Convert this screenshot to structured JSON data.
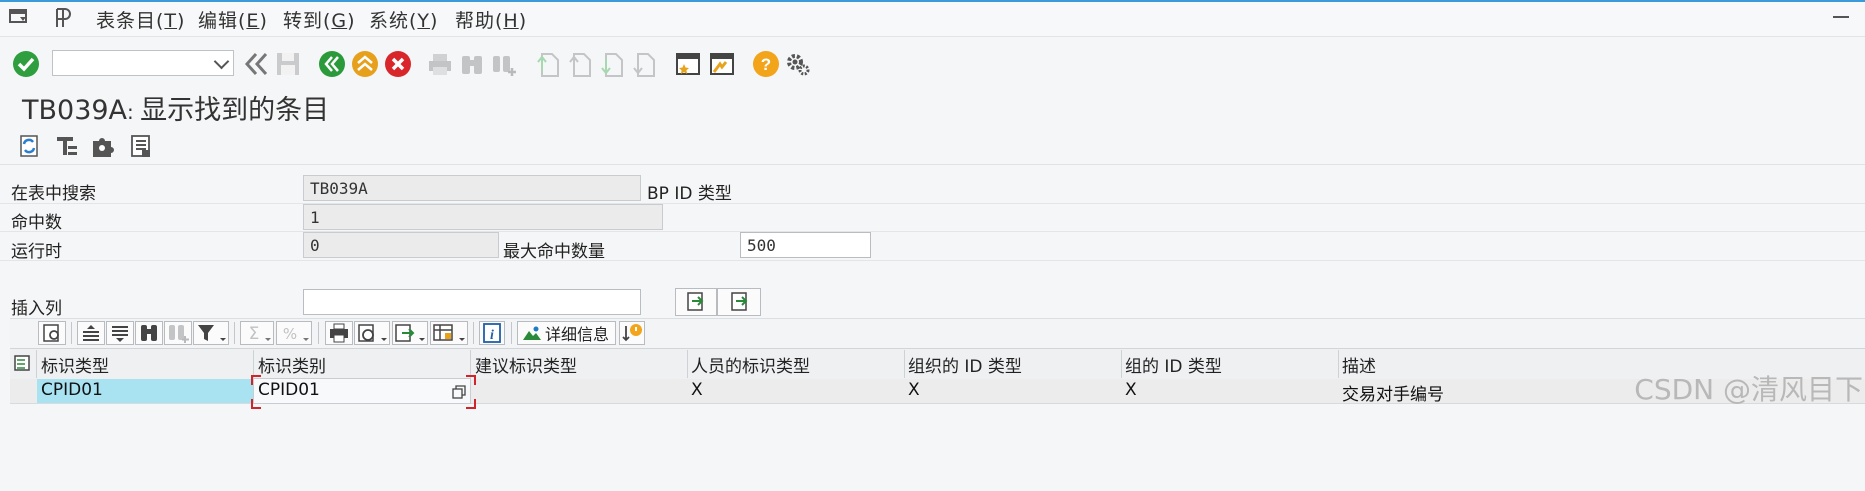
{
  "menubar": {
    "items": [
      {
        "pre": "表条目(",
        "key": "T",
        "post": ")"
      },
      {
        "pre": "编辑(",
        "key": "E",
        "post": ")"
      },
      {
        "pre": "转到(",
        "key": "G",
        "post": ")"
      },
      {
        "pre": "系统(",
        "key": "Y",
        "post": ")"
      },
      {
        "pre": "帮助(",
        "key": "H",
        "post": ")"
      }
    ]
  },
  "toolbar": {
    "command_value": ""
  },
  "page": {
    "title_code": "TB039A",
    "title_sep": ": ",
    "title_text": "显示找到的条目"
  },
  "form": {
    "search_table_label": "在表中搜索",
    "search_table_value": "TB039A",
    "search_table_desc": "BP ID 类型",
    "hits_label": "命中数",
    "hits_value": "1",
    "runtime_label": "运行时",
    "runtime_value": "0",
    "max_hits_label": "最大命中数量",
    "max_hits_value": "500",
    "insert_col_label": "插入列",
    "insert_col_value": ""
  },
  "grid": {
    "detail_button": "详细信息",
    "columns": [
      "标识类型",
      "标识类别",
      "建议标识类型",
      "人员的标识类型",
      "组织的 ID 类型",
      "组的 ID 类型",
      "描述"
    ],
    "rows": [
      [
        "CPID01",
        "CPID01",
        "",
        "X",
        "X",
        "X",
        "交易对手编号"
      ]
    ]
  },
  "watermark": "CSDN @清风目下",
  "colors": {
    "accent": "#3b9bd9",
    "ok_green": "#2e9e3e",
    "nav_green": "#2a9a3a",
    "exit_orange": "#e6a01c",
    "cancel_red": "#d9262b",
    "help_orange": "#f2a41b",
    "selected_cell": "#a9e3f2"
  }
}
